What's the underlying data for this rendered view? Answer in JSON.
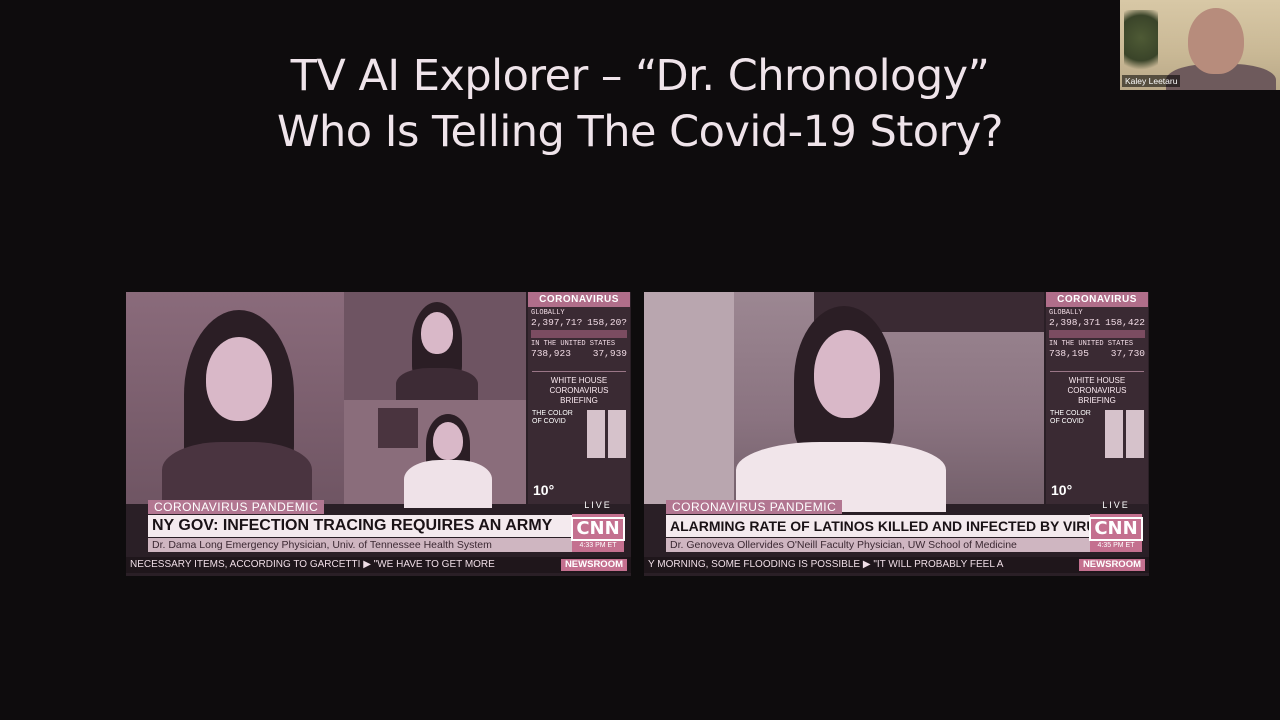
{
  "slide": {
    "title_line1": "TV AI Explorer – “Dr. Chronology”",
    "title_line2": "Who Is Telling The Covid-19 Story?"
  },
  "self_view": {
    "name": "Kaley Leetaru"
  },
  "tv_left": {
    "side": {
      "header": "CORONAVIRUS",
      "global_label": "GLOBALLY",
      "cases": "2,397,71?",
      "deaths": "158,20?",
      "us_label": "IN THE UNITED STATES",
      "us_cases": "738,923",
      "us_deaths": "37,939",
      "briefing": "WHITE HOUSE CORONAVIRUS BRIEFING",
      "promo": "THE COLOR OF COVID",
      "temp": "10°"
    },
    "chyron_top": "CORONAVIRUS PANDEMIC",
    "chyron_main": "NY GOV: INFECTION TRACING REQUIRES AN ARMY",
    "chyron_sub": "Dr. Dama Long  Emergency Physician, Univ. of Tennessee Health System",
    "live": "LIVE",
    "logo": "CNN",
    "time": "4:33 PM ET",
    "ticker": "NECESSARY ITEMS, ACCORDING TO GARCETTI  ▶  \"WE HAVE TO GET MORE",
    "ticker_brand": "NEWSROOM"
  },
  "tv_right": {
    "side": {
      "header": "CORONAVIRUS",
      "global_label": "GLOBALLY",
      "cases": "2,398,371",
      "deaths": "158,422",
      "us_label": "IN THE UNITED STATES",
      "us_cases": "738,195",
      "us_deaths": "37,730",
      "briefing": "WHITE HOUSE CORONAVIRUS BRIEFING",
      "promo": "THE COLOR OF COVID",
      "temp": "10°"
    },
    "chyron_top": "CORONAVIRUS PANDEMIC",
    "chyron_main": "ALARMING RATE OF LATINOS KILLED AND INFECTED BY VIRUS",
    "chyron_sub": "Dr. Genoveva Ollervides O'Neill  Faculty Physician, UW School of Medicine",
    "live": "LIVE",
    "logo": "CNN",
    "time": "4:35 PM ET",
    "ticker": "Y MORNING, SOME FLOODING IS POSSIBLE  ▶  \"IT WILL PROBABLY FEEL A",
    "ticker_brand": "NEWSROOM"
  }
}
